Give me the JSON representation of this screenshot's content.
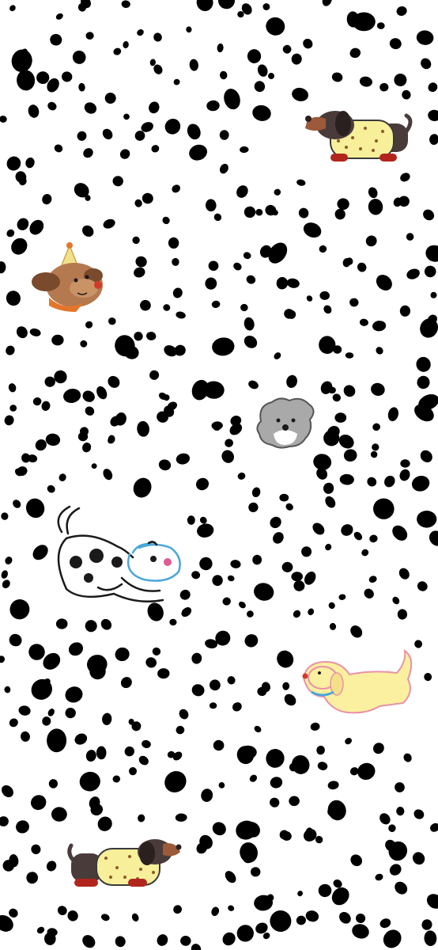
{
  "wallpaper": {
    "pattern": "dalmatian spots",
    "background_color": "#ffffff",
    "spot_color": "#000000",
    "illustrations": [
      "dachshund-in-yellow-sweater",
      "brown-puppy-with-party-hat",
      "grey-fluffy-puppy-face",
      "dalmatian-puppy-outline",
      "golden-puppy-outline",
      "dachshund-in-yellow-sweater"
    ],
    "colors": {
      "sweater": "#f7ef9a",
      "dachshund_body": "#4a3b3b",
      "dachshund_muzzle": "#9c5a3a",
      "shoes": "#b2251d",
      "brown_puppy": "#b5794f",
      "brown_puppy_ears": "#7a4a2d",
      "party_hat": "#f3e08a",
      "scarf": "#e3762b",
      "grey_puppy": "#a9a9a9",
      "golden_fill": "#fbf0a0",
      "golden_outline": "#e892a8",
      "collar_blue": "#4aa7d8",
      "pink_nose": "#e05a93"
    }
  }
}
